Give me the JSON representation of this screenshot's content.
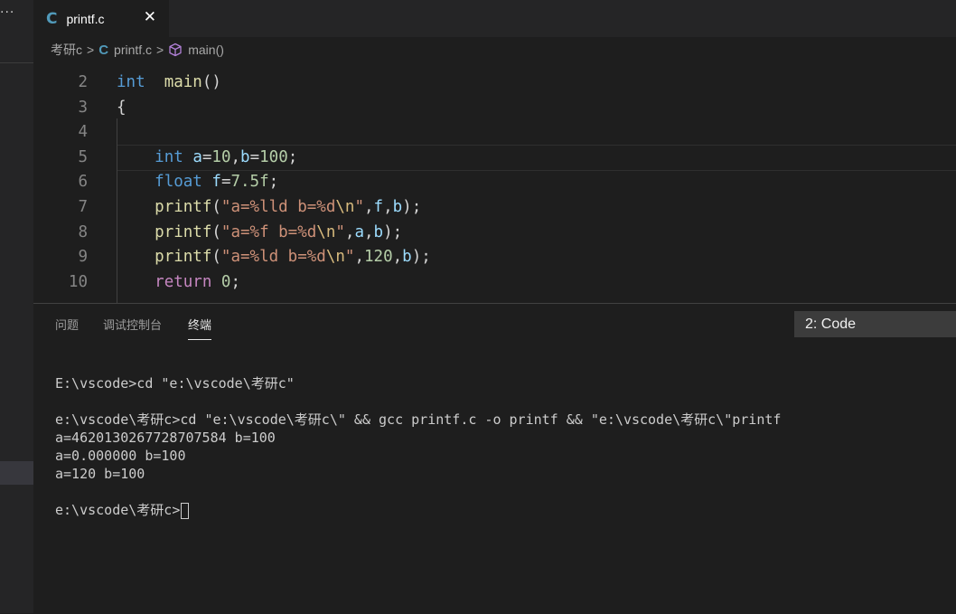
{
  "sidebar": {
    "overflow_glyph": "···"
  },
  "tabs": [
    {
      "icon_glyph": "C",
      "label": "printf.c",
      "close_glyph": "✕"
    }
  ],
  "breadcrumb": {
    "folder": "考研c",
    "file": "printf.c",
    "symbol": "main()",
    "separator": ">"
  },
  "editor": {
    "lines": [
      {
        "n": "2",
        "tokens": [
          [
            "kw",
            "int"
          ],
          [
            "",
            "  "
          ],
          [
            "fn",
            "main"
          ],
          [
            "",
            "()"
          ]
        ]
      },
      {
        "n": "3",
        "tokens": [
          [
            "",
            "{"
          ]
        ]
      },
      {
        "n": "4",
        "tokens": []
      },
      {
        "n": "5",
        "tokens": [
          [
            "",
            "    "
          ],
          [
            "kw",
            "int"
          ],
          [
            "",
            " "
          ],
          [
            "var",
            "a"
          ],
          [
            "",
            "="
          ],
          [
            "num",
            "10"
          ],
          [
            "",
            ","
          ],
          [
            "var",
            "b"
          ],
          [
            "",
            "="
          ],
          [
            "num",
            "100"
          ],
          [
            "",
            ";"
          ]
        ]
      },
      {
        "n": "6",
        "tokens": [
          [
            "",
            "    "
          ],
          [
            "kw",
            "float"
          ],
          [
            "",
            " "
          ],
          [
            "var",
            "f"
          ],
          [
            "",
            "="
          ],
          [
            "num",
            "7.5f"
          ],
          [
            "",
            ";"
          ]
        ]
      },
      {
        "n": "7",
        "tokens": [
          [
            "",
            "    "
          ],
          [
            "fn",
            "printf"
          ],
          [
            "",
            "("
          ],
          [
            "str",
            "\"a=%lld b=%d"
          ],
          [
            "esc",
            "\\n"
          ],
          [
            "str",
            "\""
          ],
          [
            "",
            ","
          ],
          [
            "var",
            "f"
          ],
          [
            "",
            ","
          ],
          [
            "var",
            "b"
          ],
          [
            "",
            ");"
          ]
        ]
      },
      {
        "n": "8",
        "tokens": [
          [
            "",
            "    "
          ],
          [
            "fn",
            "printf"
          ],
          [
            "",
            "("
          ],
          [
            "str",
            "\"a=%f b=%d"
          ],
          [
            "esc",
            "\\n"
          ],
          [
            "str",
            "\""
          ],
          [
            "",
            ","
          ],
          [
            "var",
            "a"
          ],
          [
            "",
            ","
          ],
          [
            "var",
            "b"
          ],
          [
            "",
            ");"
          ]
        ]
      },
      {
        "n": "9",
        "tokens": [
          [
            "",
            "    "
          ],
          [
            "fn",
            "printf"
          ],
          [
            "",
            "("
          ],
          [
            "str",
            "\"a=%ld b=%d"
          ],
          [
            "esc",
            "\\n"
          ],
          [
            "str",
            "\""
          ],
          [
            "",
            ","
          ],
          [
            "num",
            "120"
          ],
          [
            "",
            ","
          ],
          [
            "var",
            "b"
          ],
          [
            "",
            ");"
          ]
        ]
      },
      {
        "n": "10",
        "tokens": [
          [
            "",
            "    "
          ],
          [
            "ctl",
            "return"
          ],
          [
            "",
            " "
          ],
          [
            "num",
            "0"
          ],
          [
            "",
            ";"
          ]
        ]
      }
    ]
  },
  "panel": {
    "tabs": [
      "问题",
      "调试控制台",
      "终端"
    ],
    "active_tab": "终端",
    "terminal_select": "2: Code",
    "terminal_lines": [
      "E:\\vscode>cd \"e:\\vscode\\考研c\"",
      "",
      "e:\\vscode\\考研c>cd \"e:\\vscode\\考研c\\\" && gcc printf.c -o printf && \"e:\\vscode\\考研c\\\"printf",
      "a=4620130267728707584 b=100",
      "a=0.000000 b=100",
      "a=120 b=100",
      "",
      "e:\\vscode\\考研c>"
    ]
  },
  "colors": {
    "keyword": "#569cd6",
    "function": "#dcdcaa",
    "string": "#ce9178",
    "escape": "#d7ba7d",
    "number": "#b5cea8",
    "variable": "#9cdcfe",
    "control": "#c586c0",
    "file_icon": "#519aba"
  }
}
